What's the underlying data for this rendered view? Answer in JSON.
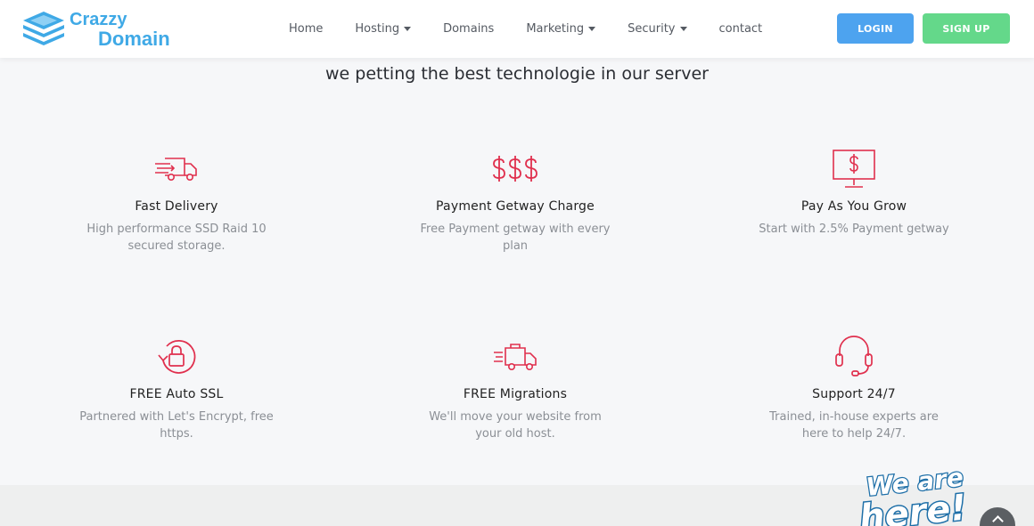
{
  "brand": {
    "line1": "Crazzy",
    "line2": "Domain",
    "color": "#3fa9e6"
  },
  "nav": {
    "items": [
      {
        "label": "Home",
        "dropdown": false
      },
      {
        "label": "Hosting",
        "dropdown": true
      },
      {
        "label": "Domains",
        "dropdown": false
      },
      {
        "label": "Marketing",
        "dropdown": true
      },
      {
        "label": "Security",
        "dropdown": true
      },
      {
        "label": "contact",
        "dropdown": false
      }
    ],
    "login_label": "LOGIN",
    "signup_label": "SIGN UP"
  },
  "colors": {
    "accent": "#e0304e",
    "login": "#4da3ef",
    "signup": "#64d88a"
  },
  "headline": "we petting the best technologie in our server",
  "features": [
    {
      "icon": "delivery-truck-icon",
      "title": "Fast Delivery",
      "desc": "High performance SSD Raid 10 secured storage."
    },
    {
      "icon": "dollar-signs-icon",
      "title": "Payment Getway Charge",
      "desc": "Free Payment getway with every plan"
    },
    {
      "icon": "dollar-monitor-icon",
      "title": "Pay As You Grow",
      "desc": "Start with 2.5% Payment getway"
    },
    {
      "icon": "ssl-lock-icon",
      "title": "FREE Auto SSL",
      "desc": "Partnered with Let's Encrypt, free https."
    },
    {
      "icon": "migration-truck-icon",
      "title": "FREE Migrations",
      "desc": "We'll move your website from your old host."
    },
    {
      "icon": "headset-icon",
      "title": "Support 24/7",
      "desc": "Trained, in-house experts are here to help 24/7."
    }
  ],
  "chat_badge": {
    "line1": "We are",
    "line2": "here!"
  }
}
